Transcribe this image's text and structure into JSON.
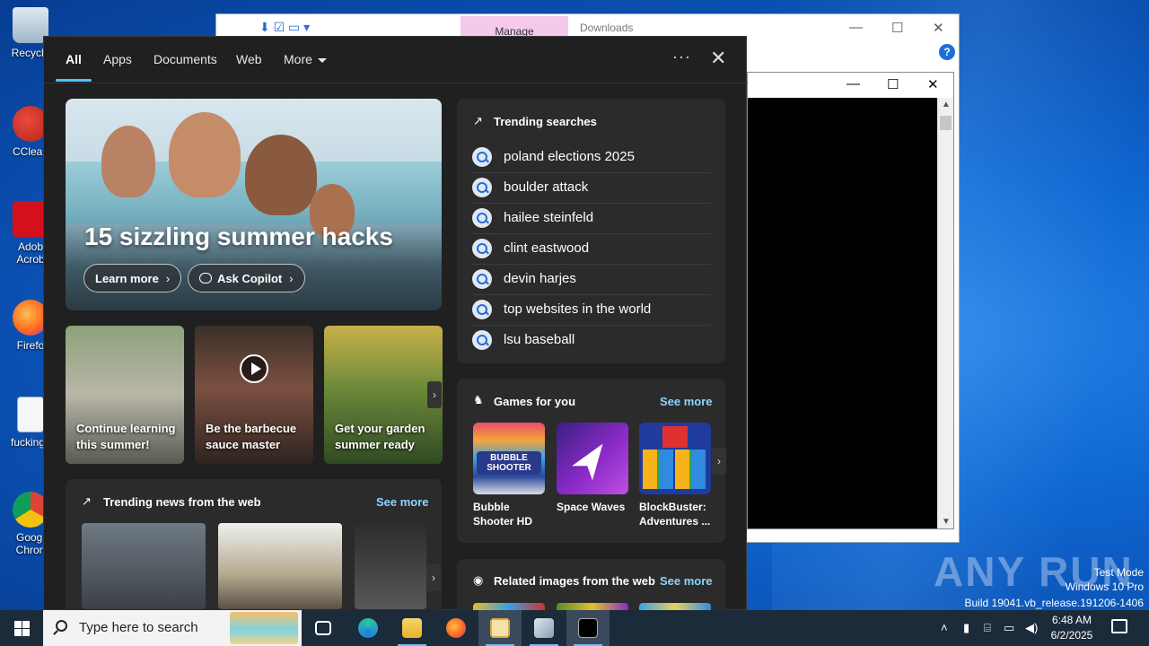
{
  "desktop": {
    "icons": [
      {
        "label": "Recycle",
        "icon": "recycle-bin-icon"
      },
      {
        "label": "CClean",
        "icon": "ccleaner-icon"
      },
      {
        "label": "Adob Acrob",
        "icon": "acrobat-icon"
      },
      {
        "label": "Firefo",
        "icon": "firefox-icon"
      },
      {
        "label": "fuckings",
        "icon": "file-icon"
      },
      {
        "label": "Googl Chron",
        "icon": "chrome-icon"
      }
    ]
  },
  "explorer": {
    "manage_tab": "Manage",
    "title": "Downloads",
    "minimize": "—",
    "maximize": "☐",
    "close": "✕",
    "help": "?"
  },
  "console": {
    "minimize": "—",
    "maximize": "☐",
    "close": "✕"
  },
  "search_panel": {
    "tabs": [
      "All",
      "Apps",
      "Documents",
      "Web",
      "More"
    ],
    "active_tab": "All",
    "more_dots": "···",
    "close": "✕",
    "hero": {
      "title": "15 sizzling summer hacks",
      "learn_more": "Learn more",
      "ask_copilot": "Ask Copilot"
    },
    "cards": [
      {
        "text": "Continue learning this summer!"
      },
      {
        "text": "Be the barbecue sauce master"
      },
      {
        "text": "Get your garden summer ready"
      }
    ],
    "trending_news": {
      "title": "Trending news from the web",
      "see_more": "See more"
    },
    "trending_searches": {
      "title": "Trending searches",
      "items": [
        "poland elections 2025",
        "boulder attack",
        "hailee steinfeld",
        "clint eastwood",
        "devin harjes",
        "top websites in the world",
        "lsu baseball"
      ]
    },
    "games": {
      "title": "Games for you",
      "see_more": "See more",
      "items": [
        {
          "name": "Bubble Shooter HD",
          "tile_label": "BUBBLE SHOOTER"
        },
        {
          "name": "Space Waves",
          "tile_label": ""
        },
        {
          "name": "BlockBuster: Adventures ...",
          "tile_label": ""
        }
      ]
    },
    "related_images": {
      "title": "Related images from the web",
      "see_more": "See more"
    }
  },
  "watermark": {
    "text": "ANY RUN",
    "mode": "Test Mode",
    "os": "Windows 10 Pro",
    "build": "Build 19041.vb_release.191206-1406"
  },
  "taskbar": {
    "search_placeholder": "Type here to search",
    "time": "6:48 AM",
    "date": "6/2/2025",
    "apps": [
      "task-view-icon",
      "edge-icon",
      "file-explorer-icon",
      "firefox-icon",
      "notes-icon",
      "photos-icon",
      "cmd-icon"
    ]
  }
}
